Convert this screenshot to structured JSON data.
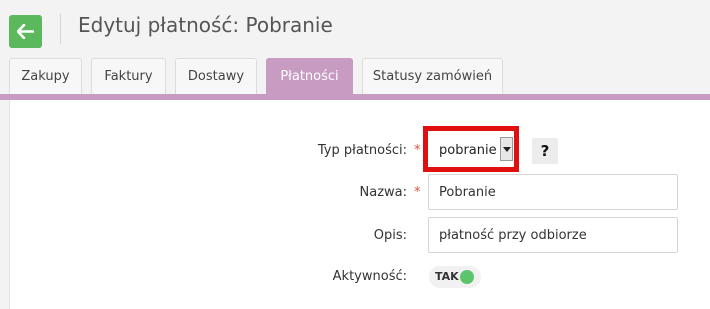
{
  "header": {
    "title": "Edytuj płatność: Pobranie",
    "back_color": "#5cb85c"
  },
  "tabs": [
    {
      "label": "Zakupy",
      "active": false
    },
    {
      "label": "Faktury",
      "active": false
    },
    {
      "label": "Dostawy",
      "active": false
    },
    {
      "label": "Płatności",
      "active": true
    },
    {
      "label": "Statusy zamówień",
      "active": false
    }
  ],
  "accent_color": "#c79bc2",
  "form": {
    "payment_type": {
      "label": "Typ płatności:",
      "required": "*",
      "value": "pobranie",
      "help": "?"
    },
    "name": {
      "label": "Nazwa:",
      "required": "*",
      "value": "Pobranie"
    },
    "description": {
      "label": "Opis:",
      "value": "płatność przy odbiorze"
    },
    "active": {
      "label": "Aktywność:",
      "toggle_label": "TAK",
      "on": true
    }
  },
  "highlight_color": "#e01010"
}
